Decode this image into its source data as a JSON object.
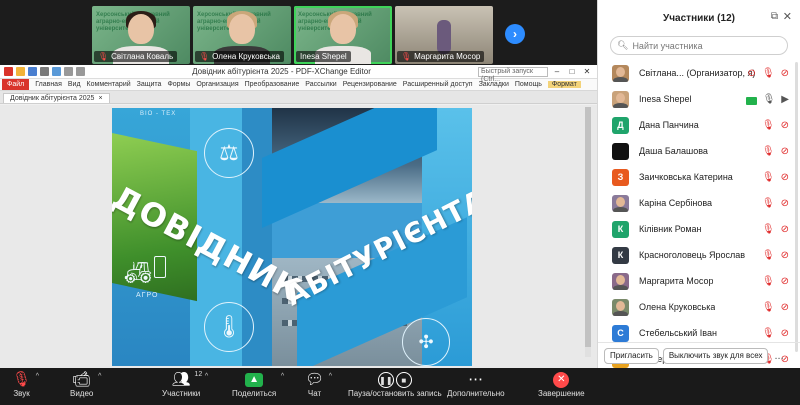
{
  "thumbnails": [
    {
      "name": "Світлана Коваль",
      "banner": "Херсонський державний аграрно-економічний університет",
      "muted": true
    },
    {
      "name": "Олена Круковська",
      "banner": "Херсонський державний аграрно-економічний університет",
      "muted": true
    },
    {
      "name": "Inesa Shepel",
      "banner": "Херсонський державний аграрно-економічний університет",
      "muted": false
    },
    {
      "name": "Маргарита Мосор",
      "banner": "",
      "muted": true
    }
  ],
  "editor": {
    "title": "Довідник абітурієнта 2025 - PDF-XChange Editor",
    "quick_search": "Быстрый запуск (Ctrl...",
    "ribbon": [
      "Файл",
      "Главная",
      "Вид",
      "Комментарий",
      "Защита",
      "Формы",
      "Организация",
      "Преобразование",
      "Рассылки",
      "Рецензирование",
      "Расширенный доступ",
      "Закладки",
      "Помощь"
    ],
    "format_tab": "Формат",
    "doc_tab": "Довідник абітурієнта 2025",
    "doc_close": "×"
  },
  "cover": {
    "title_left": "ДОВІДНИК",
    "title_right": "АБІТУРІЄНТА",
    "label_top": "BIO - TEX",
    "label_agro": "АГРО"
  },
  "toolbar": {
    "mute": "Звук",
    "video": "Видео",
    "participants": "Участники",
    "participants_count": "12",
    "share": "Поделиться",
    "chat": "Чат",
    "record": "Пауза/остановить запись",
    "more": "Дополнительно",
    "end": "Завершение"
  },
  "panel": {
    "title": "Участники (12)",
    "search_placeholder": "Найти участника",
    "participants": [
      {
        "initial": "",
        "name": "Світлана... (Организатор, я)",
        "color": "#b4885c",
        "photo": true,
        "mic": "off",
        "cam": "off",
        "extra": "record"
      },
      {
        "initial": "",
        "name": "Inesa Shepel",
        "color": "#c9a27a",
        "photo": true,
        "mic": "on",
        "cam": "on",
        "extra": "share"
      },
      {
        "initial": "Д",
        "name": "Дана Панчина",
        "color": "#1fa46b",
        "photo": false,
        "mic": "off",
        "cam": "off",
        "extra": ""
      },
      {
        "initial": "",
        "name": "Даша Балашова",
        "color": "#111111",
        "photo": false,
        "mic": "off",
        "cam": "off",
        "extra": ""
      },
      {
        "initial": "З",
        "name": "Заичковська Катерина",
        "color": "#e85a1f",
        "photo": false,
        "mic": "off",
        "cam": "off",
        "extra": ""
      },
      {
        "initial": "",
        "name": "Каріна Сербінова",
        "color": "#8a7a9a",
        "photo": true,
        "mic": "off",
        "cam": "off",
        "extra": ""
      },
      {
        "initial": "К",
        "name": "Кілівник Роман",
        "color": "#1fa46b",
        "photo": false,
        "mic": "off",
        "cam": "off",
        "extra": ""
      },
      {
        "initial": "К",
        "name": "Красноголовець Ярослав",
        "color": "#333a44",
        "photo": false,
        "mic": "off",
        "cam": "off",
        "extra": ""
      },
      {
        "initial": "",
        "name": "Маргарита Мосор",
        "color": "#8a6a8a",
        "photo": true,
        "mic": "off",
        "cam": "off",
        "extra": ""
      },
      {
        "initial": "",
        "name": "Олена Круковська",
        "color": "#7a8a6a",
        "photo": true,
        "mic": "off",
        "cam": "off",
        "extra": ""
      },
      {
        "initial": "С",
        "name": "Стебельський Іван",
        "color": "#2d7bd6",
        "photo": false,
        "mic": "off",
        "cam": "off",
        "extra": ""
      },
      {
        "initial": "ч",
        "name": "четверикова анастасія",
        "color": "#e8a21f",
        "photo": false,
        "mic": "off",
        "cam": "off",
        "extra": ""
      }
    ],
    "invite": "Пригласить",
    "mute_all": "Выключить звук для всех",
    "more": "..."
  }
}
